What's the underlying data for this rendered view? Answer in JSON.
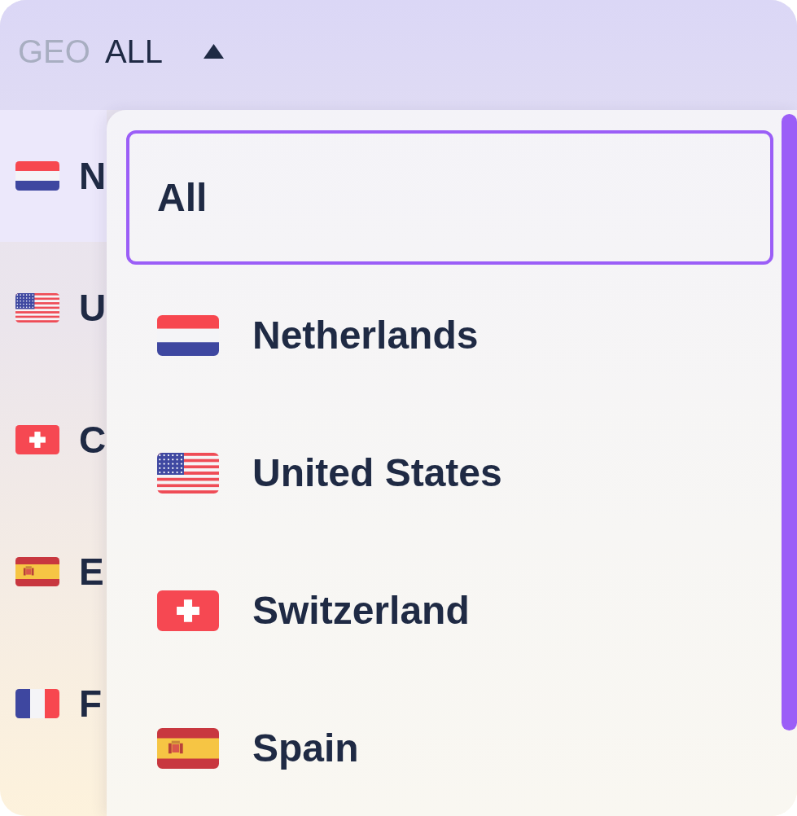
{
  "filter": {
    "label": "GEO",
    "value": "ALL",
    "expanded": true
  },
  "countries": [
    {
      "kind": "nl",
      "name": "N",
      "selected": true
    },
    {
      "kind": "us",
      "name": "U",
      "selected": false
    },
    {
      "kind": "ch",
      "name": "C",
      "selected": false
    },
    {
      "kind": "es",
      "name": "E",
      "selected": false
    },
    {
      "kind": "fr",
      "name": "F",
      "selected": false
    }
  ],
  "menu": {
    "options": [
      {
        "kind": "plain",
        "label": "All",
        "selected": true
      },
      {
        "kind": "nl",
        "label": "Netherlands",
        "selected": false
      },
      {
        "kind": "us",
        "label": "United States",
        "selected": false
      },
      {
        "kind": "ch",
        "label": "Switzerland",
        "selected": false
      },
      {
        "kind": "es",
        "label": "Spain",
        "selected": false
      }
    ]
  }
}
